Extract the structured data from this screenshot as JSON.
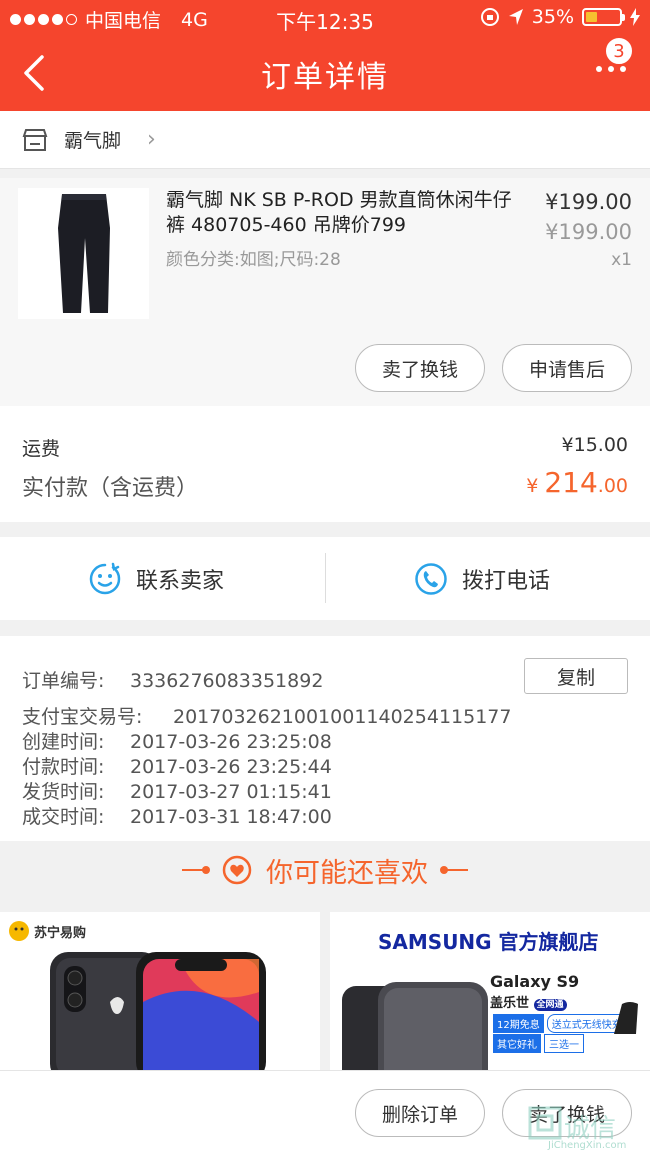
{
  "status_bar": {
    "carrier": "中国电信",
    "network": "4G",
    "time": "下午12:35",
    "battery": "35%",
    "battery_level": 0.35
  },
  "nav": {
    "title": "订单详情",
    "badge": "3"
  },
  "shop": {
    "name": "霸气脚"
  },
  "product": {
    "title": "霸气脚 NK SB P-ROD 男款直筒休闲牛仔裤 480705-460 吊牌价799",
    "sku": "颜色分类:如图;尺码:28",
    "price": "¥199.00",
    "original_price": "¥199.00",
    "quantity": "x1",
    "sell_button": "卖了换钱",
    "after_sale_button": "申请售后"
  },
  "fees": {
    "shipping_label": "运费",
    "shipping_value": "¥15.00",
    "paid_label": "实付款（含运费）",
    "paid_currency": "¥",
    "paid_integer": "214",
    "paid_decimal": ".00"
  },
  "contact": {
    "seller_label": "联系卖家",
    "phone_label": "拨打电话"
  },
  "order_info": {
    "copy_button": "复制",
    "rows": [
      {
        "key": "订单编号:",
        "value": "3336276083351892"
      },
      {
        "key": "支付宝交易号:",
        "value": "2017032621001001140254115177"
      },
      {
        "key": "创建时间:",
        "value": "2017-03-26 23:25:08"
      },
      {
        "key": "付款时间:",
        "value": "2017-03-26 23:25:44"
      },
      {
        "key": "发货时间:",
        "value": "2017-03-27 01:15:41"
      },
      {
        "key": "成交时间:",
        "value": "2017-03-31 18:47:00"
      }
    ]
  },
  "recommend": {
    "title": "你可能还喜欢",
    "card1_brand": "苏宁易购",
    "card2_brand": "SAMSUNG 官方旗舰店",
    "card2_model": "Galaxy S9",
    "card2_model_cn": "盖乐世",
    "card2_tag": "全网通",
    "card2_promo1": "12期免息",
    "card2_promo2": "送立式无线快充",
    "card2_promo3": "其它好礼",
    "card2_promo4": "三选一"
  },
  "bottom_bar": {
    "delete_button": "删除订单",
    "sell_button": "卖了换钱"
  },
  "watermark": {
    "text": "诚信",
    "sub": "JiChengXin.com"
  },
  "colors": {
    "accent": "#f5452d",
    "price_accent": "#f5652d",
    "contact_icon": "#2aa3e8"
  }
}
